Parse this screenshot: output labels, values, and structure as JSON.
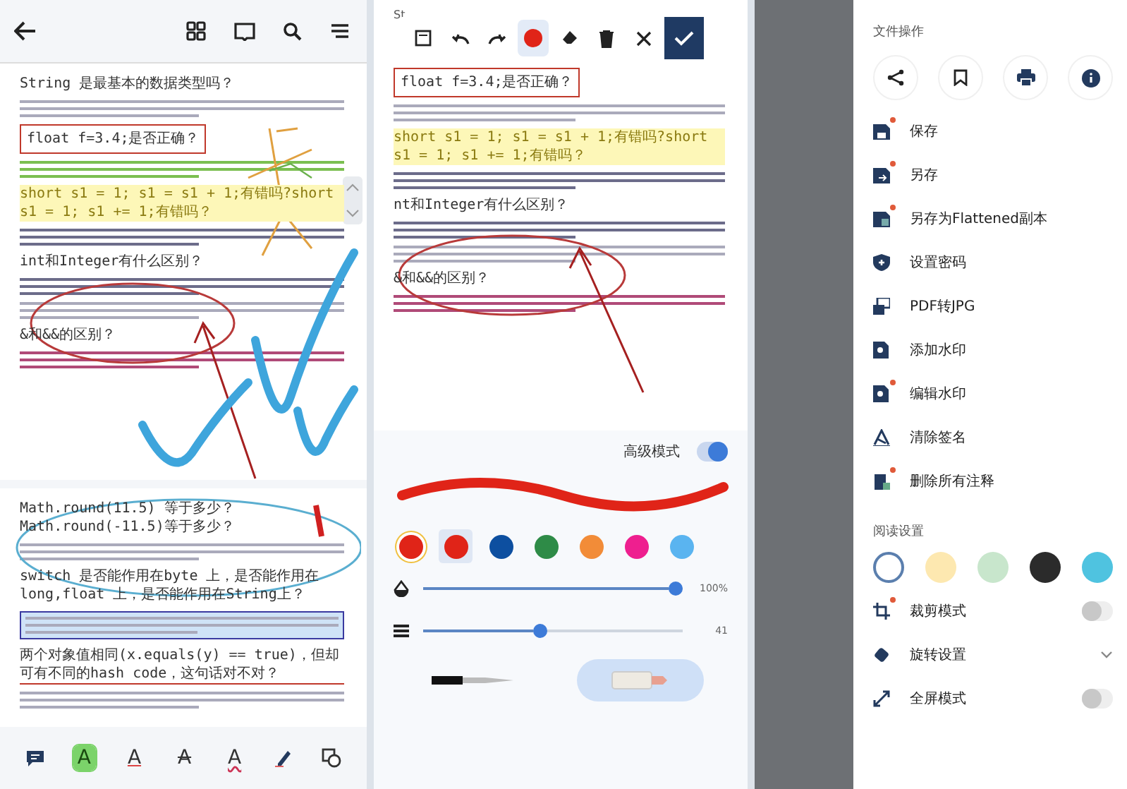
{
  "reader": {
    "doc": [
      {
        "kind": "heading",
        "text": "String 是最基本的数据类型吗？"
      },
      {
        "kind": "text"
      },
      {
        "kind": "boxed-heading",
        "text": "float f=3.4;是否正确？"
      },
      {
        "kind": "green-text"
      },
      {
        "kind": "highlighted-heading",
        "text": "short s1 = 1; s1 = s1 + 1;有错吗?short s1 = 1; s1 += 1;有错吗？"
      },
      {
        "kind": "underlined-text"
      },
      {
        "kind": "heading",
        "text": "int和Integer有什么区别？"
      },
      {
        "kind": "underlined-text"
      },
      {
        "kind": "text"
      },
      {
        "kind": "heading",
        "text": "&和&&的区别？"
      },
      {
        "kind": "pink-text"
      }
    ],
    "page2": [
      {
        "kind": "heading",
        "text": "Math.round(11.5) 等于多少？Math.round(-11.5)等于多少？"
      },
      {
        "kind": "text"
      },
      {
        "kind": "heading",
        "text": "switch 是否能作用在byte 上，是否能作用在long,float 上，是否能作用在String上？"
      },
      {
        "kind": "selected-text"
      },
      {
        "kind": "underlined-heading",
        "text": "两个对象值相同(x.equals(y) == true)，但却可有不同的hash code，这句话对不对？"
      },
      {
        "kind": "text"
      }
    ],
    "tools": [
      {
        "kind": "comment",
        "selected": false
      },
      {
        "kind": "highlight",
        "label": "A",
        "selected": true
      },
      {
        "kind": "underline",
        "label": "A",
        "selected": false
      },
      {
        "kind": "strike",
        "label": "A",
        "selected": false
      },
      {
        "kind": "squiggly",
        "label": "A",
        "selected": false
      },
      {
        "kind": "pen",
        "selected": false
      },
      {
        "kind": "shapes",
        "selected": false
      }
    ]
  },
  "editor": {
    "heading": "St",
    "tools": [
      {
        "kind": "save",
        "selected": false
      },
      {
        "kind": "undo",
        "selected": false
      },
      {
        "kind": "redo",
        "selected": false
      },
      {
        "kind": "pen",
        "selected": true
      },
      {
        "kind": "eraser",
        "selected": false
      },
      {
        "kind": "delete",
        "selected": false
      },
      {
        "kind": "close",
        "selected": false
      },
      {
        "kind": "confirm",
        "selected": false
      }
    ],
    "doc": [
      {
        "kind": "boxed-heading",
        "text": "float f=3.4;是否正确？"
      },
      {
        "kind": "text"
      },
      {
        "kind": "highlighted-heading",
        "text": "short s1 = 1; s1 = s1 + 1;有错吗?short s1 = 1; s1 += 1;有错吗？"
      },
      {
        "kind": "underlined-text"
      },
      {
        "kind": "heading",
        "text": "nt和Integer有什么区别？"
      },
      {
        "kind": "underlined-text"
      },
      {
        "kind": "text"
      },
      {
        "kind": "heading",
        "text": "&和&&的区别？"
      },
      {
        "kind": "pink-text"
      }
    ],
    "advanced_label": "高级模式",
    "advanced_on": true,
    "colors": [
      {
        "kind": "custom",
        "color": "#e02418",
        "selected": false
      },
      {
        "kind": "swatch",
        "color": "#e02418",
        "selected": true
      },
      {
        "kind": "swatch",
        "color": "#0d4fa0",
        "selected": false
      },
      {
        "kind": "swatch",
        "color": "#2e8b47",
        "selected": false
      },
      {
        "kind": "swatch",
        "color": "#f28c38",
        "selected": false
      },
      {
        "kind": "swatch",
        "color": "#ee1f8f",
        "selected": false
      },
      {
        "kind": "swatch",
        "color": "#5ab4f0",
        "selected": false
      }
    ],
    "sliders": [
      {
        "kind": "opacity",
        "level": 1,
        "reading": "100%"
      },
      {
        "kind": "width",
        "level": 0.45,
        "reading": "41"
      }
    ],
    "tips": [
      {
        "kind": "marker",
        "selected": false
      },
      {
        "kind": "highlighter",
        "selected": true
      }
    ]
  },
  "drawer": {
    "section": "文件操作",
    "quick": [
      {
        "kind": "share"
      },
      {
        "kind": "bookmark"
      },
      {
        "kind": "print"
      },
      {
        "kind": "info"
      }
    ],
    "items": [
      {
        "kind": "save",
        "label": "保存",
        "badge": true
      },
      {
        "kind": "save-as",
        "label": "另存",
        "badge": true
      },
      {
        "kind": "flatten",
        "label": "另存为Flattened副本",
        "badge": true
      },
      {
        "kind": "shield",
        "label": "设置密码",
        "badge": false
      },
      {
        "kind": "images",
        "label": "PDF转JPG",
        "badge": false
      },
      {
        "kind": "watermark",
        "label": "添加水印",
        "badge": false
      },
      {
        "kind": "watermark",
        "label": "编辑水印",
        "badge": true
      },
      {
        "kind": "signature",
        "label": "清除签名",
        "badge": false
      },
      {
        "kind": "clear",
        "label": "删除所有注释",
        "badge": true
      }
    ],
    "reading_section": "阅读设置",
    "themes": [
      {
        "color": "#ffffff",
        "selected": true
      },
      {
        "color": "#fde8b0",
        "selected": false
      },
      {
        "color": "#c8e6cc",
        "selected": false
      },
      {
        "color": "#2b2b2b",
        "selected": false
      },
      {
        "color": "#4fc3e0",
        "selected": false
      }
    ],
    "settings": [
      {
        "kind": "toggle",
        "label": "裁剪模式",
        "badge": true,
        "on": false
      },
      {
        "kind": "expand",
        "label": "旋转设置",
        "badge": false
      },
      {
        "kind": "toggle",
        "label": "全屏模式",
        "badge": false,
        "on": false
      }
    ]
  }
}
